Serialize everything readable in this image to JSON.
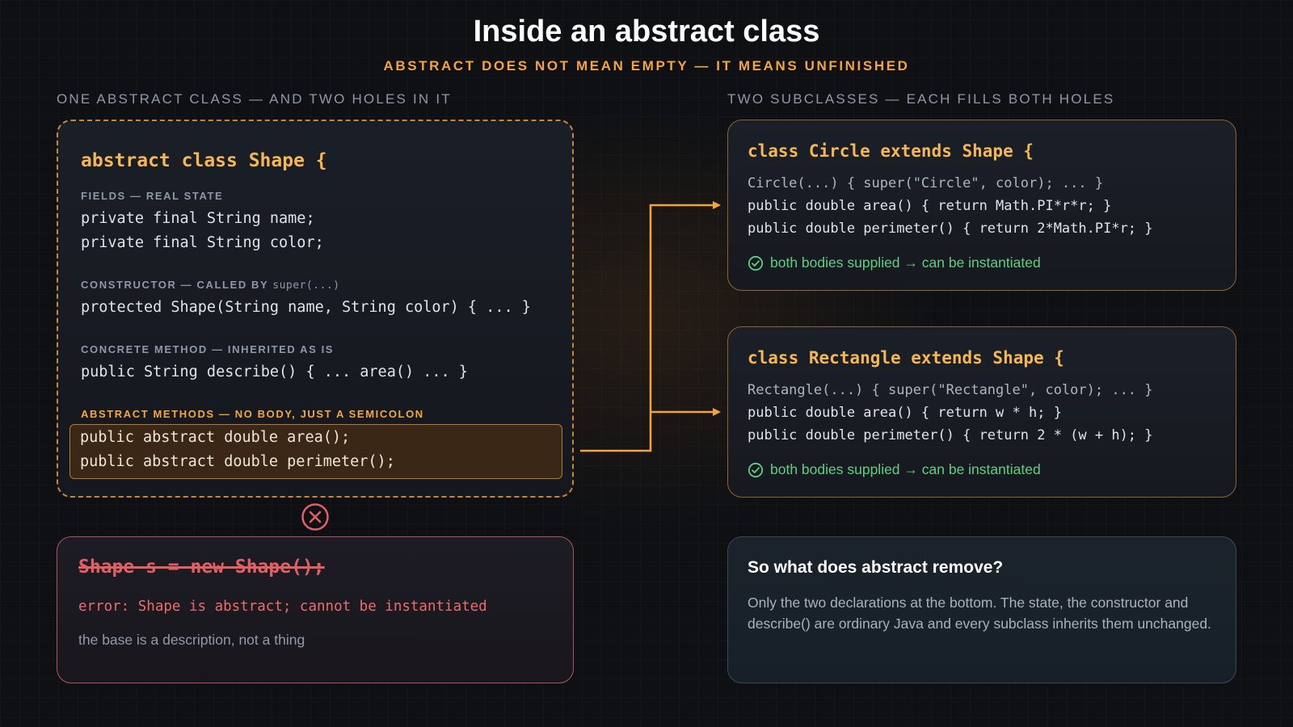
{
  "header": {
    "title": "Inside an abstract class",
    "subtitle": "ABSTRACT DOES NOT MEAN EMPTY — IT MEANS UNFINISHED"
  },
  "left_section_label": "ONE ABSTRACT CLASS — AND TWO HOLES IN IT",
  "right_section_label": "TWO SUBCLASSES — EACH FILLS BOTH HOLES",
  "shape_card": {
    "title": "abstract class Shape {",
    "fields_label": "FIELDS — REAL STATE",
    "fields": [
      "private final String name;",
      "private final String color;"
    ],
    "constructor_label": "CONSTRUCTOR — CALLED BY",
    "constructor_label_code": "super(...)",
    "constructor_code": "protected Shape(String name, String color) { ... }",
    "concrete_label": "CONCRETE METHOD — INHERITED AS IS",
    "concrete_code": "public String describe() { ... area() ... }",
    "abstract_label": "ABSTRACT METHODS — NO BODY, JUST A SEMICOLON",
    "abstract_methods": [
      "public abstract double area();",
      "public abstract double perimeter();"
    ]
  },
  "error_card": {
    "icon": "x-circle-icon",
    "struck_code": "Shape s = new Shape();",
    "error_message": "error: Shape is abstract; cannot be instantiated",
    "note": "the base is a description, not a thing"
  },
  "circle_card": {
    "title": "class Circle extends Shape {",
    "lines": [
      "Circle(...) { super(\"Circle\", color); ... }",
      "public double area() { return Math.PI*r*r; }",
      "public double perimeter() { return 2*Math.PI*r; }"
    ],
    "status": "both bodies supplied → can be instantiated"
  },
  "rectangle_card": {
    "title": "class Rectangle extends Shape {",
    "lines": [
      "Rectangle(...) { super(\"Rectangle\", color); ... }",
      "public double area() { return w * h; }",
      "public double perimeter() { return 2 * (w + h); }"
    ],
    "status": "both bodies supplied → can be instantiated"
  },
  "info_card": {
    "title": "So what does abstract remove?",
    "body": "Only the two declarations at the bottom. The state, the constructor and describe() are ordinary Java and every subclass inherits them unchanged."
  },
  "colors": {
    "accent_orange": "#f5a340",
    "success_green": "#5fcf7f",
    "error_red": "#e25f66",
    "background": "#0e1014"
  }
}
